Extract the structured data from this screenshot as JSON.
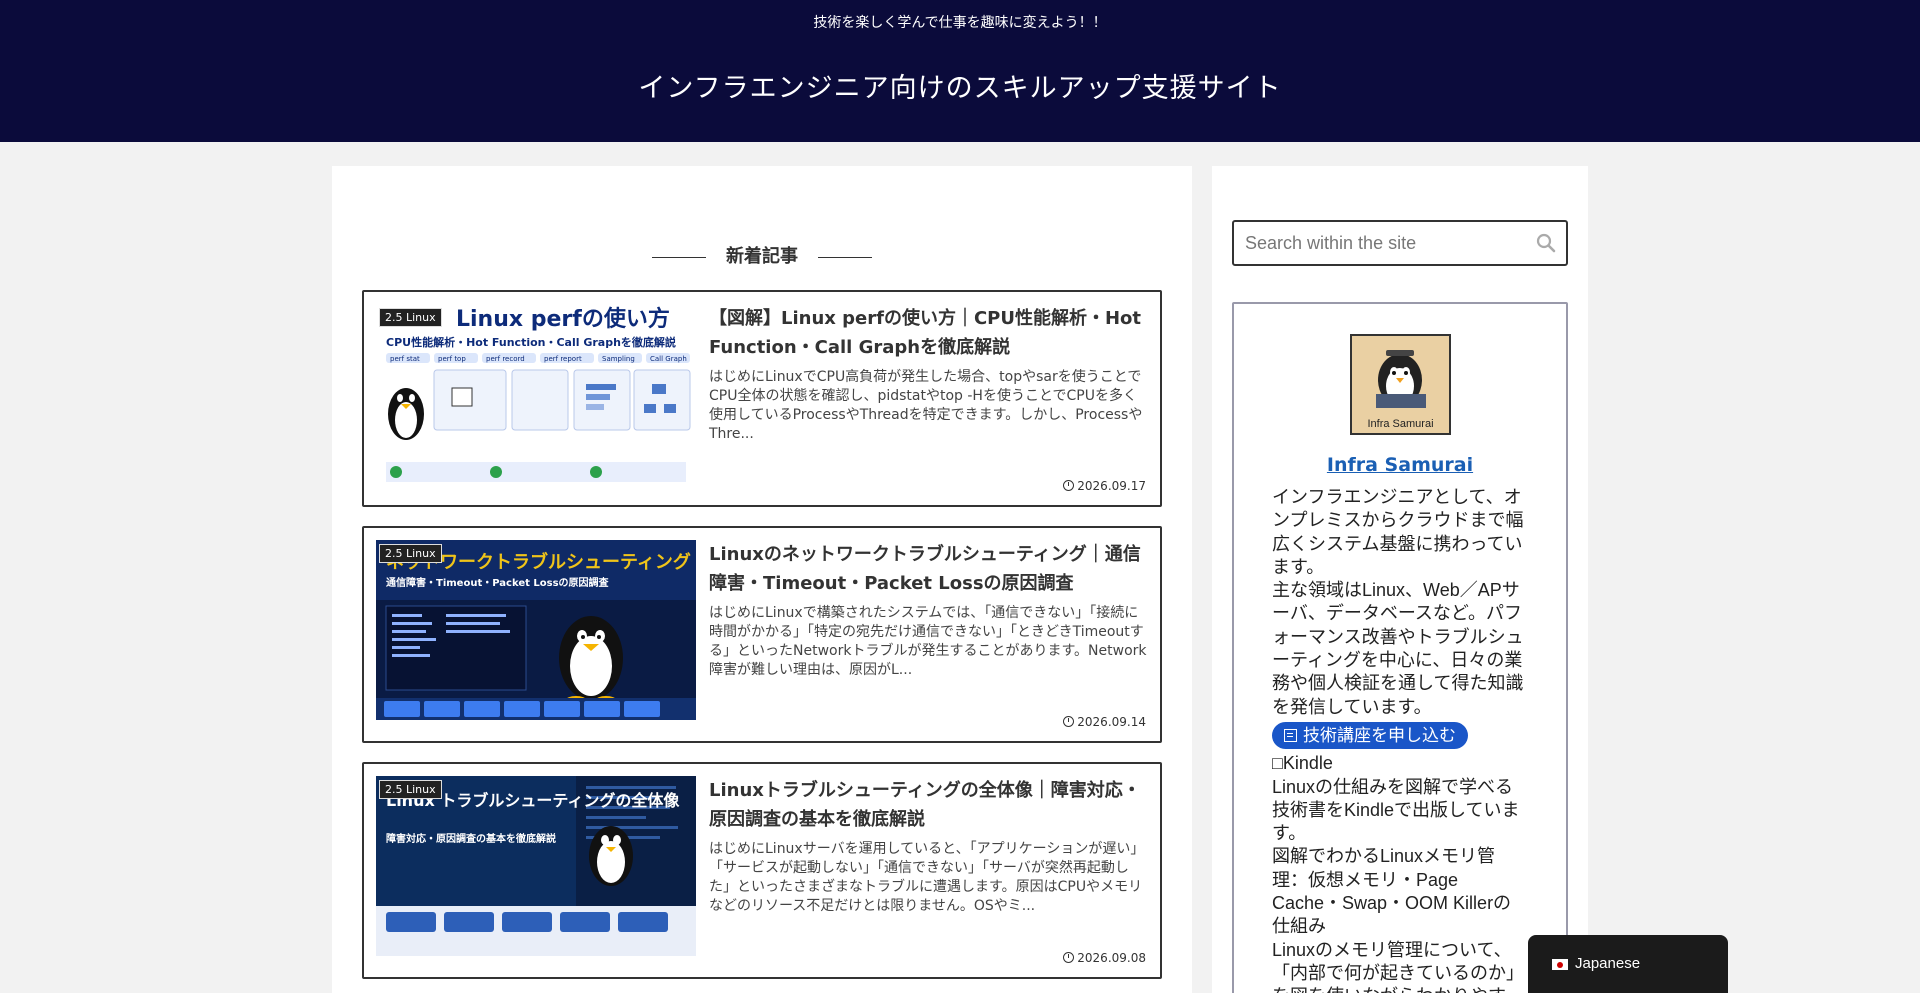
{
  "header": {
    "tagline": "技術を楽しく学んで仕事を趣味に変えよう！！",
    "site_title": "インフラエンジニア向けのスキルアップ支援サイト"
  },
  "main": {
    "section_title": "新着記事",
    "articles": [
      {
        "category": "2.5 Linux",
        "title": "【図解】Linux perfの使い方｜CPU性能解析・Hot Function・Call Graphを徹底解説",
        "snippet": "はじめにLinuxでCPU高負荷が発生した場合、topやsarを使うことでCPU全体の状態を確認し、pidstatやtop -Hを使うことでCPUを多く使用しているProcessやThreadを特定できます。しかし、ProcessやThre...",
        "date": "2026.09.17",
        "thumb_title": "Linux perfの使い方",
        "thumb_sub": "CPU性能解析・Hot Function・Call Graphを徹底解説",
        "thumb_tags": [
          "perf stat",
          "perf top",
          "perf record",
          "perf report",
          "Sampling",
          "Call Graph"
        ]
      },
      {
        "category": "2.5 Linux",
        "title": "Linuxのネットワークトラブルシューティング｜通信障害・Timeout・Packet Lossの原因調査",
        "snippet": "はじめにLinuxで構築されたシステムでは、「通信できない」「接続に時間がかかる」「特定の宛先だけ通信できない」「ときどきTimeoutする」といったNetworkトラブルが発生することがあります。Network障害が難しい理由は、原因がL...",
        "date": "2026.09.14",
        "thumb_title": "ネットワークトラブルシューティング",
        "thumb_sub": "通信障害・Timeout・Packet Lossの原因調査",
        "thumb_tags": []
      },
      {
        "category": "2.5 Linux",
        "title": "Linuxトラブルシューティングの全体像｜障害対応・原因調査の基本を徹底解説",
        "snippet": "はじめにLinuxサーバを運用していると、「アプリケーションが遅い」「サービスが起動しない」「通信できない」「サーバが突然再起動した」といったさまざまなトラブルに遭遇します。原因はCPUやメモリなどのリソース不足だけとは限りません。OSやミ...",
        "date": "2026.09.08",
        "thumb_title": "Linux トラブルシューティングの全体像",
        "thumb_sub": "障害対応・原因調査の基本を徹底解説",
        "thumb_tags": []
      }
    ]
  },
  "sidebar": {
    "search_placeholder": "Search within the site",
    "avatar_label": "Infra Samurai",
    "author_name": "Infra Samurai",
    "bio_1": "インフラエンジニアとして、オンプレミスからクラウドまで幅広くシステム基盤に携わっています。",
    "bio_2": "主な領域はLinux、Web／APサーバ、データベースなど。パフォーマンス改善やトラブルシューティングを中心に、日々の業務や個人検証を通して得た知識を発信しています。",
    "apply_label": "技術講座を申し込む",
    "kindle_heading": "□Kindle",
    "kindle_text": "Linuxの仕組みを図解で学べる技術書をKindleで出版しています。",
    "book_title": "図解でわかるLinuxメモリ管理：仮想メモリ・Page Cache・Swap・OOM Killerの仕組み",
    "book_desc": "Linuxのメモリ管理について、「内部で何が起きているのか」を図を使いながらわかりやす"
  },
  "language": {
    "label": "Japanese"
  }
}
